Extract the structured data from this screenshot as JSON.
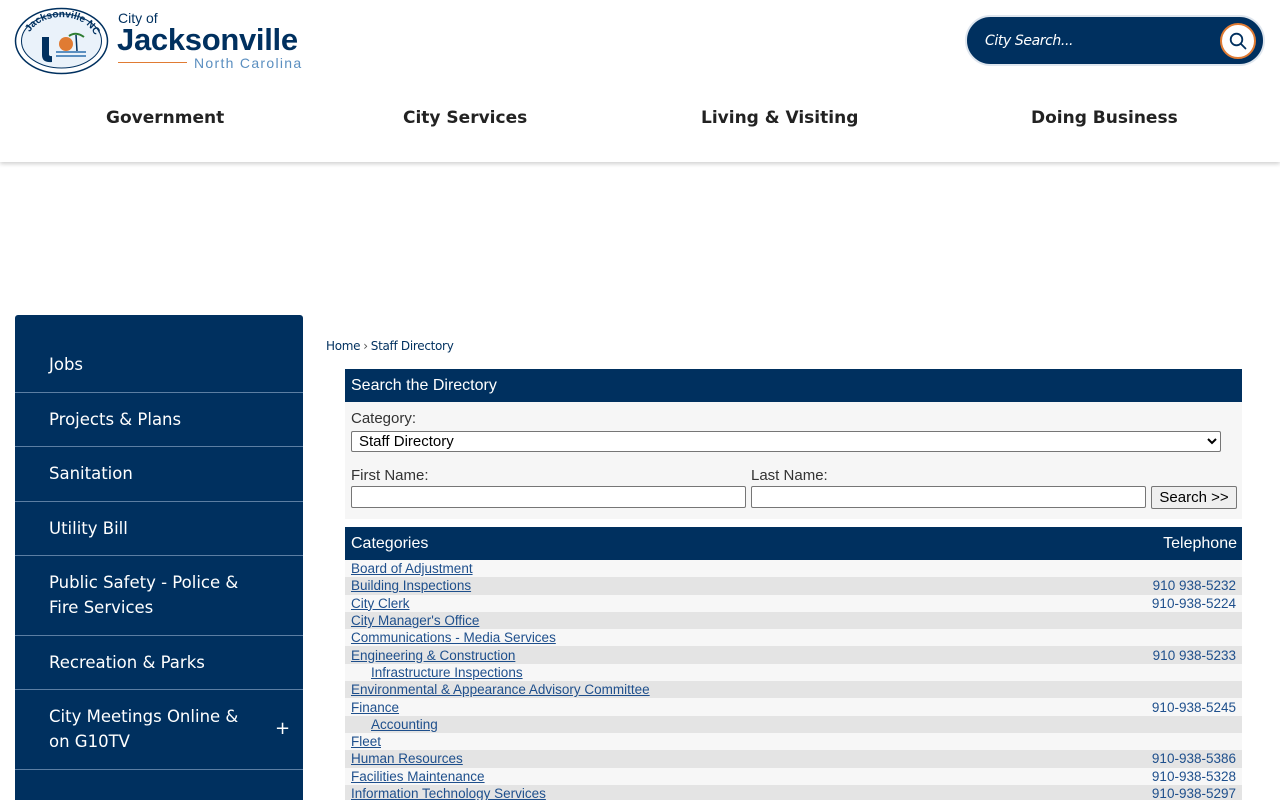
{
  "header": {
    "seal_text": "Jacksonville NC",
    "logo_small": "City of",
    "logo_main": "Jacksonville",
    "logo_sub": "North Carolina",
    "search_placeholder": "City Search...",
    "search_icon": "search-icon",
    "nav": [
      "Government",
      "City Services",
      "Living & Visiting",
      "Doing Business"
    ]
  },
  "sidebar": {
    "items": [
      {
        "label": "Jobs"
      },
      {
        "label": "Projects & Plans"
      },
      {
        "label": "Sanitation"
      },
      {
        "label": "Utility Bill"
      },
      {
        "label": "Public Safety - Police & Fire Services"
      },
      {
        "label": "Recreation & Parks"
      },
      {
        "label": "City Meetings Online & on G10TV",
        "expand": "+"
      }
    ]
  },
  "breadcrumb": {
    "home": "Home",
    "sep": "›",
    "current": "Staff Directory"
  },
  "search_panel": {
    "title": "Search the Directory",
    "category_label": "Category:",
    "category_value": "Staff Directory",
    "first_label": "First Name:",
    "last_label": "Last Name:",
    "button": "Search >>"
  },
  "categories": {
    "col_name": "Categories",
    "col_tel": "Telephone",
    "rows": [
      {
        "name": "Board of Adjustment",
        "tel": "",
        "sub": false
      },
      {
        "name": "Building Inspections",
        "tel": "910 938-5232",
        "sub": false
      },
      {
        "name": "City Clerk",
        "tel": "910-938-5224",
        "sub": false
      },
      {
        "name": "City Manager's Office",
        "tel": "",
        "sub": false
      },
      {
        "name": "Communications - Media Services",
        "tel": "",
        "sub": false
      },
      {
        "name": "Engineering & Construction",
        "tel": "910 938-5233",
        "sub": false
      },
      {
        "name": "Infrastructure Inspections",
        "tel": "",
        "sub": true
      },
      {
        "name": "Environmental & Appearance Advisory Committee",
        "tel": "",
        "sub": false
      },
      {
        "name": "Finance",
        "tel": "910-938-5245",
        "sub": false
      },
      {
        "name": "Accounting",
        "tel": "",
        "sub": true
      },
      {
        "name": "Fleet",
        "tel": "",
        "sub": false
      },
      {
        "name": "Human Resources",
        "tel": "910-938-5386",
        "sub": false
      },
      {
        "name": "Facilities Maintenance",
        "tel": "910-938-5328",
        "sub": false
      },
      {
        "name": "Information Technology Services",
        "tel": "910-938-5297",
        "sub": false
      }
    ]
  },
  "colors": {
    "navy": "#00305f",
    "accent": "#e07b33",
    "link": "#1e4f8c"
  }
}
